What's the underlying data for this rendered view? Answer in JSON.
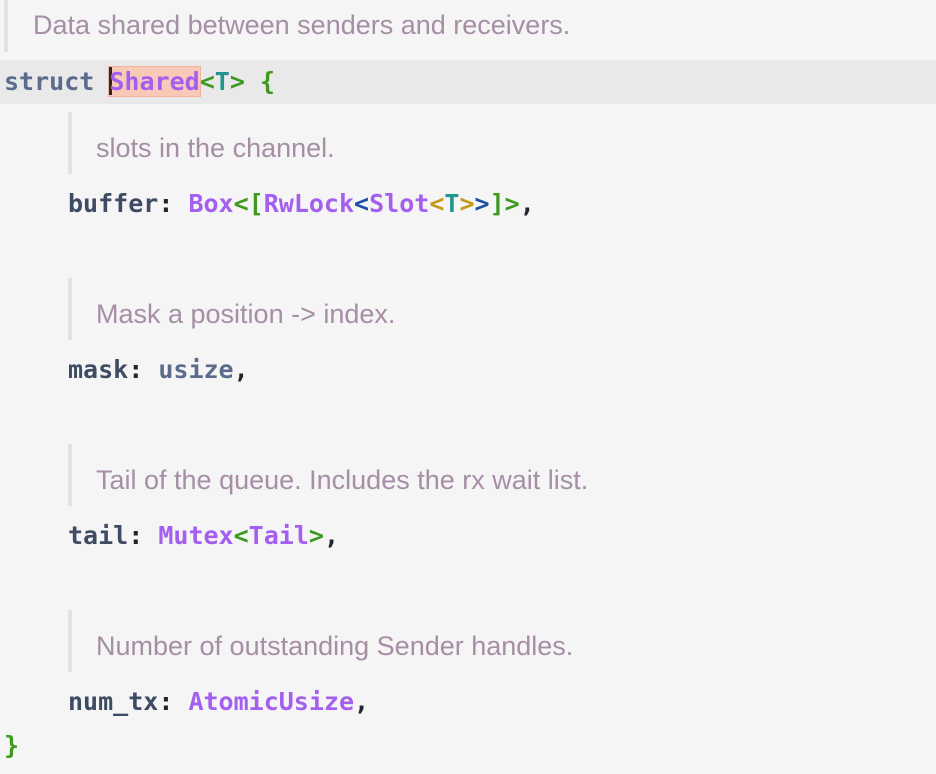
{
  "doc_comments": {
    "struct": "Data shared between senders and receivers.",
    "buffer": "slots in the channel.",
    "mask": "Mask a position -> index.",
    "tail": "Tail of the queue. Includes the rx wait list.",
    "num_tx": "Number of outstanding Sender handles."
  },
  "code": {
    "struct_keyword": "struct",
    "struct_name": "Shared",
    "generic_open": "<",
    "generic_param": "T",
    "generic_close": ">",
    "open_brace": "{",
    "close_brace": "}",
    "fields": {
      "buffer": {
        "name": "buffer",
        "colon": ":",
        "type_box": "Box",
        "lt1": "<",
        "lbracket": "[",
        "type_rwlock": "RwLock",
        "lt2": "<",
        "type_slot": "Slot",
        "lt3": "<",
        "param": "T",
        "gt3": ">",
        "gt2": ">",
        "rbracket": "]",
        "gt1": ">",
        "comma": ","
      },
      "mask": {
        "name": "mask",
        "colon": ":",
        "type": "usize",
        "comma": ","
      },
      "tail": {
        "name": "tail",
        "colon": ":",
        "type_mutex": "Mutex",
        "lt": "<",
        "type_tail": "Tail",
        "gt": ">",
        "comma": ","
      },
      "num_tx": {
        "name": "num_tx",
        "colon": ":",
        "type": "AtomicUsize",
        "comma": ","
      }
    }
  },
  "colors": {
    "background": "#f5f5f5",
    "current_line": "#e9e9ea",
    "doc_text": "#a58ea6",
    "keyword": "#5b6b8b",
    "type": "#a45ef0",
    "name_highlight": "#f8c9b6"
  }
}
